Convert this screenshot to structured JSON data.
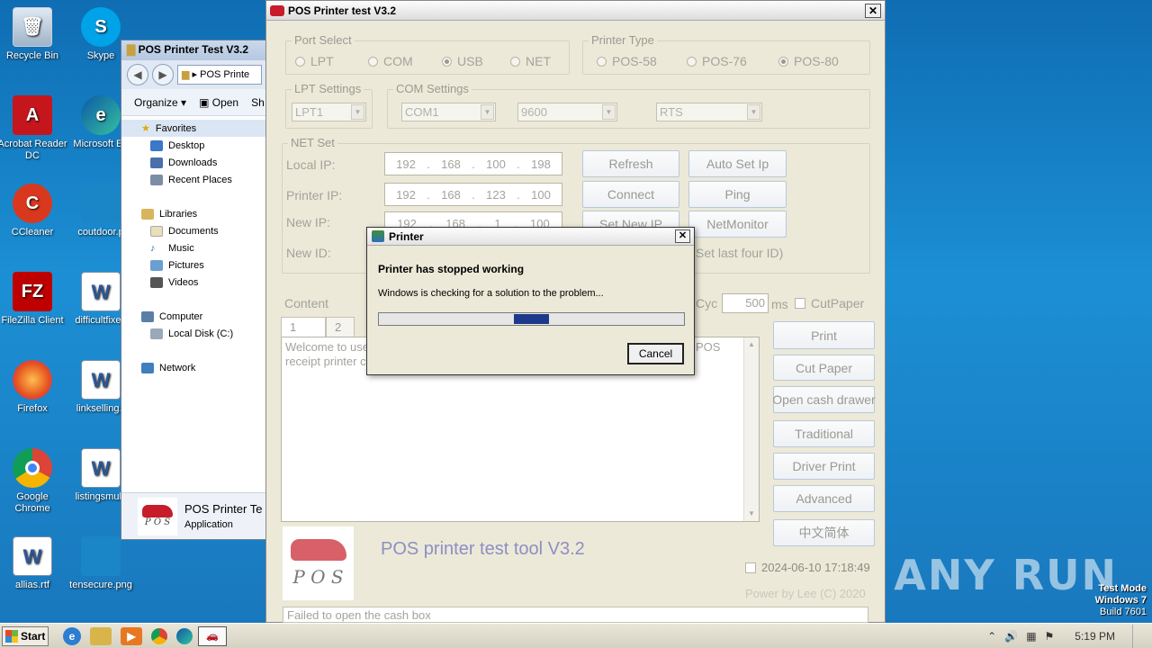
{
  "desktop": {
    "icons": [
      {
        "label": "Recycle Bin",
        "icon": "recycle-bin-icon"
      },
      {
        "label": "Skype",
        "icon": "skype-icon"
      },
      {
        "label": "Acrobat Reader DC",
        "icon": "acrobat-icon"
      },
      {
        "label": "Microsoft Ed",
        "icon": "edge-icon"
      },
      {
        "label": "CCleaner",
        "icon": "ccleaner-icon"
      },
      {
        "label": "coutdoor.p",
        "icon": "word-doc-icon"
      },
      {
        "label": "FileZilla Client",
        "icon": "filezilla-icon"
      },
      {
        "label": "difficultfixed",
        "icon": "word-doc-icon"
      },
      {
        "label": "Firefox",
        "icon": "firefox-icon"
      },
      {
        "label": "linkselling.r",
        "icon": "word-doc-icon"
      },
      {
        "label": "Google Chrome",
        "icon": "chrome-icon"
      },
      {
        "label": "listingsmulti",
        "icon": "word-doc-icon"
      },
      {
        "label": "allias.rtf",
        "icon": "word-doc-icon"
      },
      {
        "label": "tensecure.png",
        "icon": "image-file-icon"
      }
    ],
    "watermark": "ANY RUN",
    "test_mode": {
      "line1": "Test Mode",
      "line2": "Windows 7",
      "line3": "Build 7601"
    }
  },
  "explorer": {
    "title": "POS Printer Test V3.2",
    "address": "POS Printe",
    "toolbar": {
      "organize": "Organize",
      "open": "Open",
      "share": "Sh"
    },
    "tree": {
      "favorites": "Favorites",
      "desktop": "Desktop",
      "downloads": "Downloads",
      "recent": "Recent Places",
      "libraries": "Libraries",
      "documents": "Documents",
      "music": "Music",
      "pictures": "Pictures",
      "videos": "Videos",
      "computer": "Computer",
      "local_disk": "Local Disk (C:)",
      "network": "Network"
    },
    "detail": {
      "name": "POS Printer Te",
      "type": "Application"
    }
  },
  "pos": {
    "title": "POS Printer test V3.2",
    "port_select": {
      "legend": "Port Select",
      "options": [
        "LPT",
        "COM",
        "USB",
        "NET"
      ],
      "selected": "USB"
    },
    "printer_type": {
      "legend": "Printer Type",
      "options": [
        "POS-58",
        "POS-76",
        "POS-80"
      ],
      "selected": "POS-80"
    },
    "lpt_settings": {
      "legend": "LPT Settings",
      "value": "LPT1"
    },
    "com_settings": {
      "legend": "COM Settings",
      "port": "COM1",
      "baud": "9600",
      "flow": "RTS"
    },
    "net_set": {
      "legend": "NET Set",
      "local_ip_label": "Local IP:",
      "local_ip": [
        "192",
        "168",
        "100",
        "198"
      ],
      "printer_ip_label": "Printer IP:",
      "printer_ip": [
        "192",
        "168",
        "123",
        "100"
      ],
      "new_ip_label": "New IP:",
      "new_ip": [
        "192",
        "168",
        "1",
        "100"
      ],
      "new_id_label": "New ID:",
      "set_last_four": "Set last four ID)"
    },
    "buttons": {
      "refresh": "Refresh",
      "auto_set_ip": "Auto Set Ip",
      "connect": "Connect",
      "ping": "Ping",
      "set_new_ip": "Set New IP",
      "net_monitor": "NetMonitor",
      "print": "Print",
      "cut_paper": "Cut Paper",
      "open_cash_drawer": "Open cash drawer",
      "traditional": "Traditional",
      "driver_print": "Driver Print",
      "advanced": "Advanced",
      "chinese": "中文简体"
    },
    "content_label": "Content",
    "cyc_label": "Cyc",
    "cyc_value": "500",
    "ms_label": "ms",
    "cut_paper_check": "CutPaper",
    "tabs": [
      "1",
      "2"
    ],
    "content_text_line1": "Welcome to use",
    "content_text_line2": "receipt printer c",
    "content_text_right": "POS",
    "logo_text": "P O S",
    "app_name": "POS printer test tool V3.2",
    "datetime": "2024-06-10 17:18:49",
    "power_by": "Power by Lee (C) 2020",
    "status": "Failed to open the cash box"
  },
  "dialog": {
    "title": "Printer",
    "heading": "Printer has stopped working",
    "message": "Windows is checking for a solution to the problem...",
    "progress": 0.5,
    "cancel": "Cancel"
  },
  "taskbar": {
    "start": "Start",
    "clock": "5:19 PM"
  }
}
